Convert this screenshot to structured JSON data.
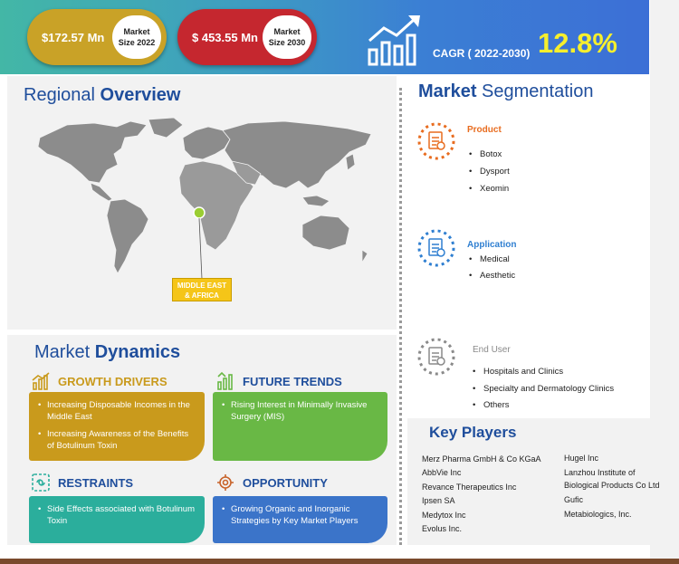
{
  "header": {
    "size_2022": {
      "value": "$172.57 Mn",
      "label_line1": "Market",
      "label_line2": "Size 2022"
    },
    "size_2030": {
      "value": "$ 453.55 Mn",
      "label_line1": "Market",
      "label_line2": "Size 2030"
    },
    "cagr_label": "CAGR ( 2022-2030)",
    "cagr_value": "12.8%",
    "icon": "growth-chart-icon"
  },
  "regional": {
    "title_part1": "Regional ",
    "title_part2": "Overview",
    "region_line1": "MIDDLE EAST",
    "region_line2": "& AFRICA",
    "highlight_color": "#9acd32"
  },
  "dynamics": {
    "title_part1": "Market ",
    "title_part2": "Dynamics",
    "growth_drivers": {
      "heading": "GROWTH DRIVERS",
      "icon": "bar-chart-icon",
      "color": "#c99a1c",
      "items": [
        "Increasing Disposable Incomes in the Middle East",
        "Increasing Awareness of the Benefits of Botulinum Toxin"
      ]
    },
    "future_trends": {
      "heading": "FUTURE TRENDS",
      "icon": "trend-icon",
      "color": "#69b845",
      "items": [
        "Rising Interest in Minimally Invasive Surgery (MIS)"
      ]
    },
    "restraints": {
      "heading": "RESTRAINTS",
      "icon": "restraint-icon",
      "color": "#2bae9c",
      "items": [
        "Side Effects associated with Botulinum Toxin"
      ]
    },
    "opportunity": {
      "heading": "OPPORTUNITY",
      "icon": "target-gear-icon",
      "color": "#3b74c9",
      "items": [
        "Growing Organic and Inorganic Strategies by Key Market Players"
      ]
    }
  },
  "segmentation": {
    "title_part1": "Market ",
    "title_part2": "Segmentation",
    "product": {
      "label": "Product",
      "color": "#e86c1f",
      "items": [
        "Botox",
        "Dysport",
        "Xeomin"
      ]
    },
    "application": {
      "label": "Application",
      "color": "#2f7fd1",
      "items": [
        "Medical",
        "Aesthetic"
      ]
    },
    "end_user": {
      "label": "End User",
      "color": "#8a8a8a",
      "items": [
        "Hospitals and Clinics",
        "Specialty and Dermatology Clinics",
        "Others"
      ]
    }
  },
  "key_players": {
    "title": "Key Players",
    "column1": [
      "Merz Pharma GmbH & Co KGaA",
      "AbbVie Inc",
      "Revance Therapeutics Inc",
      "Ipsen SA",
      "Medytox Inc",
      "Evolus Inc."
    ],
    "column2": [
      "Hugel Inc",
      "Lanzhou Institute of",
      "Biological Products Co Ltd",
      "Gufic",
      "Metabiologics, Inc."
    ]
  }
}
